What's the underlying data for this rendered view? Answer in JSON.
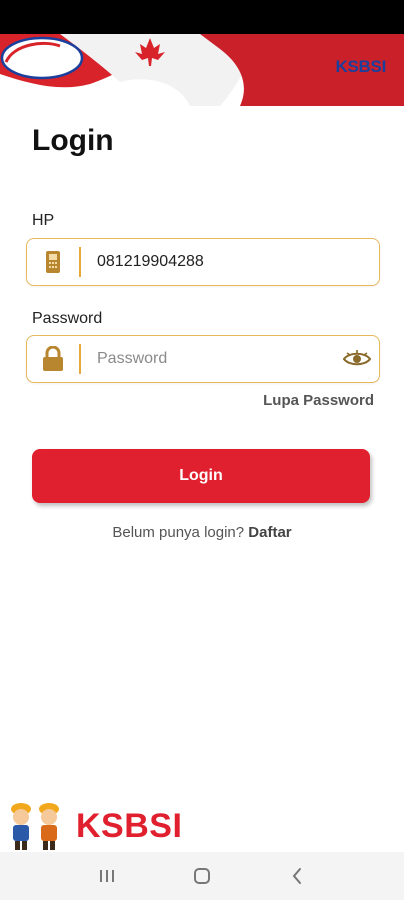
{
  "header": {
    "back_icon": "chevron-left-icon",
    "logo_text": "KSBSI"
  },
  "title": "Login",
  "hp": {
    "label": "HP",
    "value": "081219904288",
    "icon": "phone-icon"
  },
  "password": {
    "label": "Password",
    "placeholder": "Password",
    "icon": "lock-icon",
    "toggle_icon": "eye-icon"
  },
  "forgot_password": "Lupa Password",
  "login_button": "Login",
  "register": {
    "prompt": "Belum punya login? ",
    "link": "Daftar"
  },
  "footer": {
    "logo_text": "KSBSI"
  },
  "nav": {
    "recent_icon": "recent-apps-icon",
    "home_icon": "home-icon",
    "back_icon": "back-icon"
  },
  "colors": {
    "brand_red": "#e0202e",
    "field_border": "#e8b85c",
    "icon_gold": "#b8862e",
    "logo_blue": "#1b3f9c"
  }
}
